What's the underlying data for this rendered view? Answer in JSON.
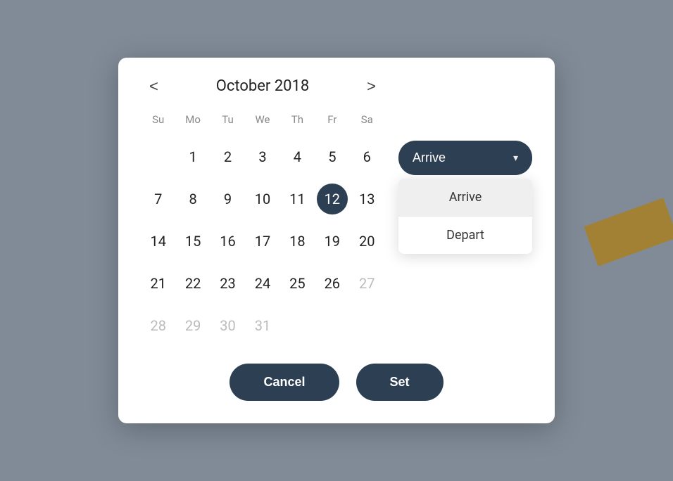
{
  "map": {
    "bg_color": "#b8c8d8"
  },
  "dialog": {
    "calendar": {
      "month_title": "October 2018",
      "days_of_week": [
        "Su",
        "Mo",
        "Tu",
        "We",
        "Th",
        "Fr",
        "Sa"
      ],
      "weeks": [
        [
          {
            "day": "",
            "disabled": false,
            "empty": true
          },
          {
            "day": "1",
            "disabled": false,
            "empty": false
          },
          {
            "day": "2",
            "disabled": false,
            "empty": false
          },
          {
            "day": "3",
            "disabled": false,
            "empty": false
          },
          {
            "day": "4",
            "disabled": false,
            "empty": false
          },
          {
            "day": "5",
            "disabled": false,
            "empty": false
          },
          {
            "day": "6",
            "disabled": false,
            "empty": false
          }
        ],
        [
          {
            "day": "7",
            "disabled": false,
            "empty": false
          },
          {
            "day": "8",
            "disabled": false,
            "empty": false
          },
          {
            "day": "9",
            "disabled": false,
            "empty": false
          },
          {
            "day": "10",
            "disabled": false,
            "empty": false
          },
          {
            "day": "11",
            "disabled": false,
            "empty": false
          },
          {
            "day": "12",
            "disabled": false,
            "selected": true,
            "empty": false
          },
          {
            "day": "13",
            "disabled": false,
            "empty": false
          }
        ],
        [
          {
            "day": "14",
            "disabled": false,
            "empty": false
          },
          {
            "day": "15",
            "disabled": false,
            "empty": false
          },
          {
            "day": "16",
            "disabled": false,
            "empty": false
          },
          {
            "day": "17",
            "disabled": false,
            "empty": false
          },
          {
            "day": "18",
            "disabled": false,
            "empty": false
          },
          {
            "day": "19",
            "disabled": false,
            "empty": false
          },
          {
            "day": "20",
            "disabled": false,
            "empty": false
          }
        ],
        [
          {
            "day": "21",
            "disabled": false,
            "empty": false
          },
          {
            "day": "22",
            "disabled": false,
            "empty": false
          },
          {
            "day": "23",
            "disabled": false,
            "empty": false
          },
          {
            "day": "24",
            "disabled": false,
            "empty": false
          },
          {
            "day": "25",
            "disabled": false,
            "empty": false
          },
          {
            "day": "26",
            "disabled": false,
            "empty": false
          },
          {
            "day": "27",
            "disabled": true,
            "empty": false
          }
        ],
        [
          {
            "day": "28",
            "disabled": true,
            "empty": false
          },
          {
            "day": "29",
            "disabled": true,
            "empty": false
          },
          {
            "day": "30",
            "disabled": true,
            "empty": false
          },
          {
            "day": "31",
            "disabled": true,
            "empty": false
          },
          {
            "day": "",
            "disabled": false,
            "empty": true
          },
          {
            "day": "",
            "disabled": false,
            "empty": true
          },
          {
            "day": "",
            "disabled": false,
            "empty": true
          }
        ]
      ],
      "nav_prev": "<",
      "nav_next": ">"
    },
    "arrive_dropdown": {
      "button_label": "Arrive",
      "chevron": "▾",
      "options": [
        "Arrive",
        "Depart"
      ]
    },
    "footer": {
      "cancel_label": "Cancel",
      "set_label": "Set"
    }
  }
}
